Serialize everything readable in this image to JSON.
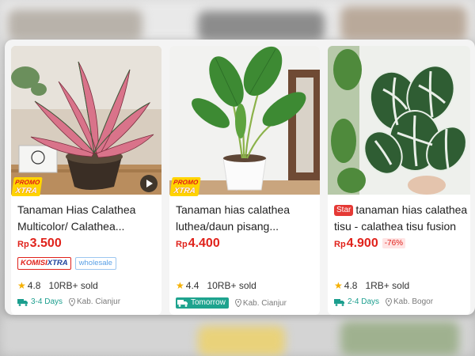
{
  "products": [
    {
      "name": "Tanaman Hias Calathea Multicolor/ Calathea...",
      "star_badge": "",
      "price_currency": "Rp",
      "price_value": "3.500",
      "discount": "",
      "promo_line1": "PROMO",
      "promo_line2": "XTRA",
      "has_video": true,
      "komisi_label_a": "KOMISI",
      "komisi_label_b": "XTRA",
      "wholesale_label": "wholesale",
      "rating": "4.8",
      "sold": "10RB+ sold",
      "delivery": "3-4 Days",
      "location": "Kab. Cianjur"
    },
    {
      "name": "Tanaman hias calathea luthea/daun pisang...",
      "star_badge": "",
      "price_currency": "Rp",
      "price_value": "4.400",
      "discount": "",
      "promo_line1": "PROMO",
      "promo_line2": "XTRA",
      "has_video": false,
      "rating": "4.4",
      "sold": "10RB+ sold",
      "delivery": "Tomorrow",
      "location": "Kab. Cianjur"
    },
    {
      "name": "tanaman hias calathea tisu - calathea tisu fusion",
      "star_badge": "Star",
      "price_currency": "Rp",
      "price_value": "4.900",
      "discount": "-76%",
      "has_video": false,
      "rating": "4.8",
      "sold": "1RB+ sold",
      "delivery": "2-4 Days",
      "location": "Kab. Bogor"
    }
  ],
  "colors": {
    "price_red": "#e0221b",
    "promo_yellow": "#ffd400",
    "delivery_teal": "#1b9e8e",
    "rating_star": "#f5b000"
  },
  "icons": [
    "play-icon",
    "star-icon",
    "delivery-truck-icon",
    "location-pin-icon"
  ]
}
